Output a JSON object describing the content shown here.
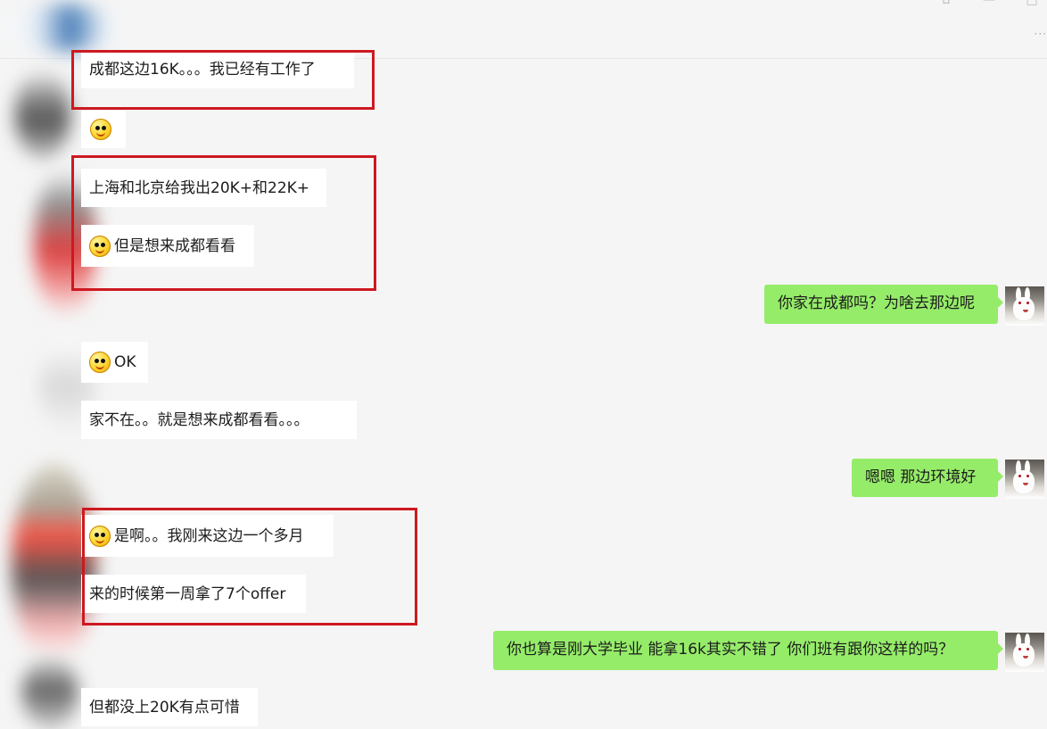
{
  "messages_left": [
    {
      "text": "成都这边16K。。。我已经有工作了"
    },
    {
      "text": ""
    },
    {
      "text": "上海和北京给我出20K+和22K+"
    },
    {
      "text": "但是想来成都看看"
    },
    {
      "text": "OK"
    },
    {
      "text": "家不在。。就是想来成都看看。。。"
    },
    {
      "text": "是啊。。我刚来这边一个多月"
    },
    {
      "text": "来的时候第一周拿了7个offer"
    },
    {
      "text": "但都没上20K有点可惜"
    }
  ],
  "messages_right": [
    {
      "text": "你家在成都吗？为啥去那边呢"
    },
    {
      "text": "嗯嗯  那边环境好"
    },
    {
      "text": "你也算是刚大学毕业  能拿16k其实不错了  你们班有跟你这样的吗？"
    }
  ],
  "window": {
    "more_menu": "···"
  },
  "theme": {
    "incoming_bubble": "#ffffff",
    "outgoing_bubble": "#95ec69",
    "annotation_box": "#cd1920",
    "background": "#f5f5f5"
  }
}
